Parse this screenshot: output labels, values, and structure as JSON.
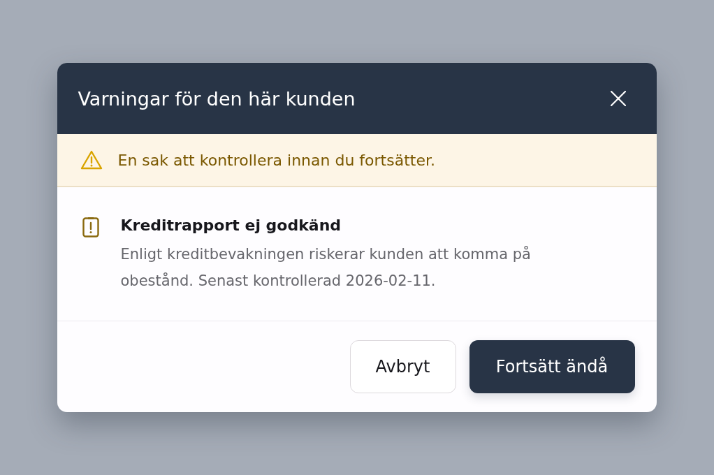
{
  "dialog": {
    "title": "Varningar för den här kunden",
    "banner": {
      "text": "En sak att kontrollera innan du fortsätter."
    },
    "warnings": [
      {
        "title": "Kreditrapport ej godkänd",
        "description": "Enligt kreditbevakningen riskerar kunden att komma på obestånd. Senast kontrollerad 2026-02-11."
      }
    ],
    "buttons": [
      {
        "label": "Avbryt",
        "kind": "secondary"
      },
      {
        "label": "Fortsätt ändå",
        "kind": "primary"
      }
    ]
  }
}
